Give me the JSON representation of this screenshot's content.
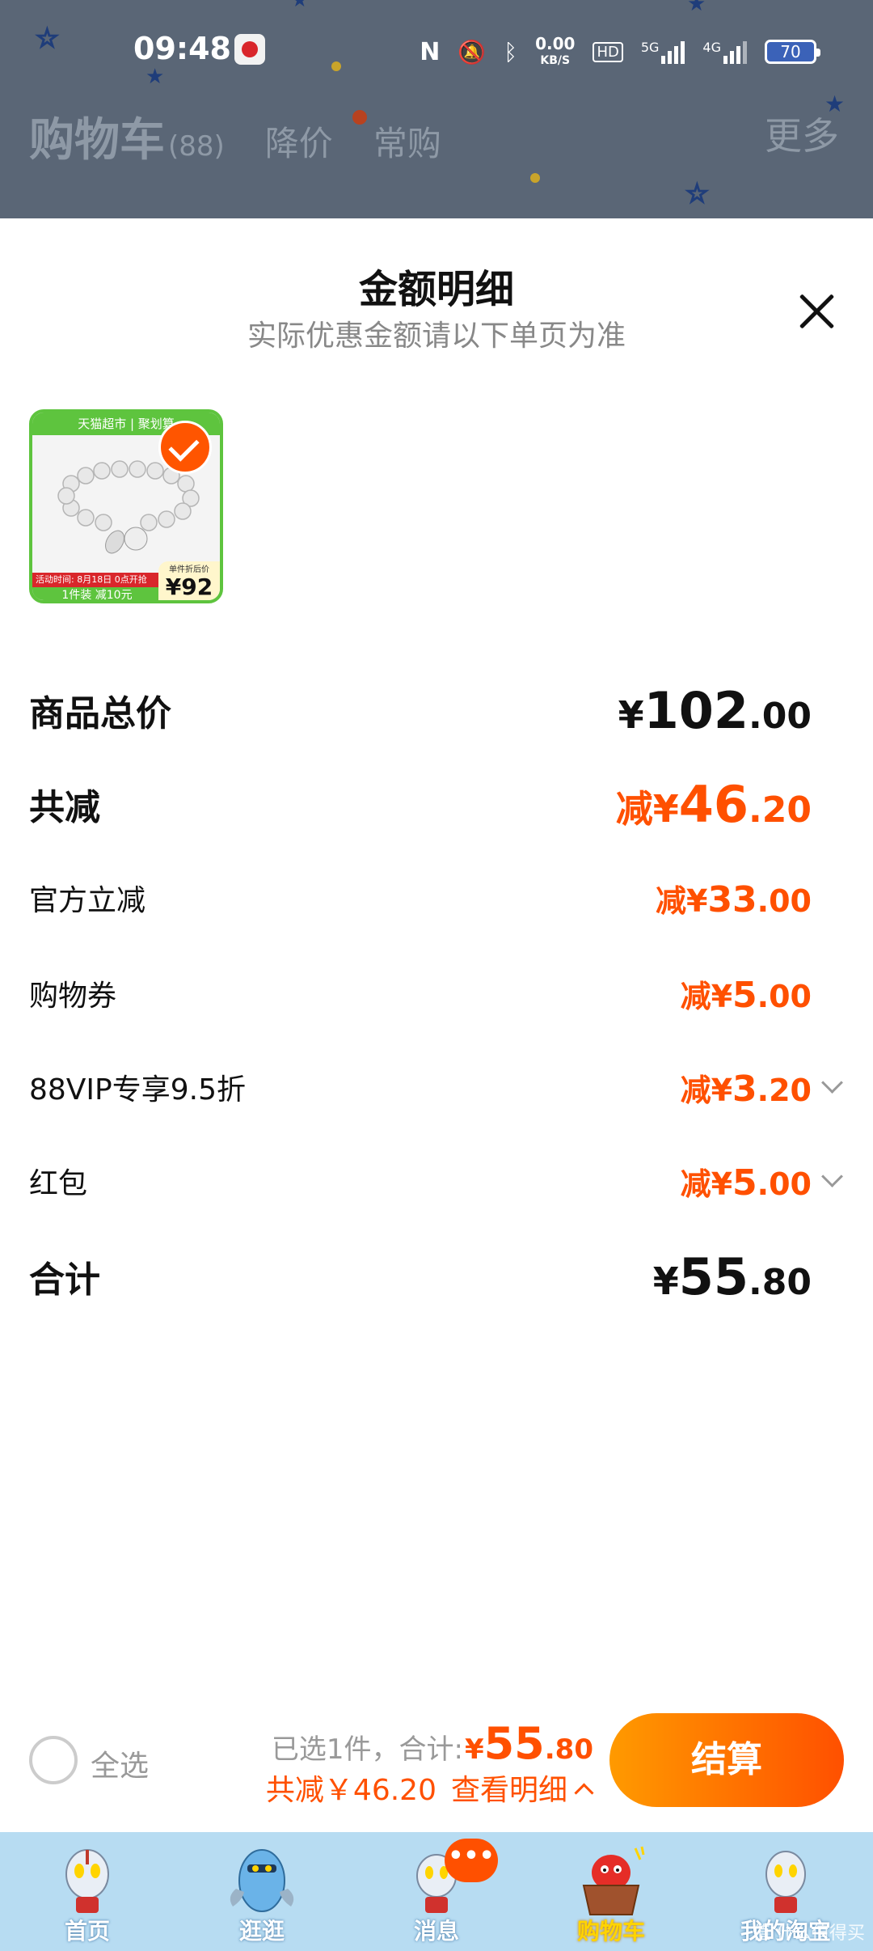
{
  "status_bar": {
    "time": "09:48",
    "net_speed_value": "0.00",
    "net_speed_unit": "KB/S",
    "hd_label": "HD",
    "signal1_label": "5G",
    "signal2_label": "4G",
    "battery": "70",
    "icons": [
      "nfc-icon",
      "mute-icon",
      "bluetooth-icon"
    ]
  },
  "cart_header": {
    "title": "购物车",
    "count": "(88)",
    "tabs": [
      "降价",
      "常购"
    ],
    "more": "更多"
  },
  "sheet": {
    "title": "金额明细",
    "subtitle": "实际优惠金额请以下单页为准"
  },
  "product": {
    "banner": "天猫超市 | 聚划算",
    "promo_line": "活动时间: 8月18日 0点开抢",
    "promo_line2": "1件装 减10元",
    "price_label": "单件折后价",
    "price": "92"
  },
  "rows": [
    {
      "label": "商品总价",
      "prefix": "",
      "currency": "¥",
      "int": "102",
      "dec": ".00"
    },
    {
      "label": "共减",
      "prefix": "减",
      "currency": "¥",
      "int": "46",
      "dec": ".20"
    },
    {
      "label": "官方立减",
      "prefix": "减",
      "currency": "¥",
      "int": "33",
      "dec": ".00"
    },
    {
      "label": "购物券",
      "prefix": "减",
      "currency": "¥",
      "int": "5",
      "dec": ".00"
    },
    {
      "label": "88VIP专享9.5折",
      "prefix": "减",
      "currency": "¥",
      "int": "3",
      "dec": ".20"
    },
    {
      "label": "红包",
      "prefix": "减",
      "currency": "¥",
      "int": "5",
      "dec": ".00"
    },
    {
      "label": "合计",
      "prefix": "",
      "currency": "¥",
      "int": "55",
      "dec": ".80"
    }
  ],
  "checkout": {
    "select_all": "全选",
    "selected_text": "已选1件，合计:",
    "total_currency": "¥",
    "total_int": "55",
    "total_dec": ".80",
    "discount_text": "共减￥46.20",
    "detail_link": "查看明细",
    "button": "结算"
  },
  "tabbar": {
    "items": [
      {
        "label": "首页"
      },
      {
        "label": "逛逛"
      },
      {
        "label": "消息"
      },
      {
        "label": "购物车"
      },
      {
        "label": "我的淘宝"
      }
    ],
    "message_badge": "•••",
    "watermark": "值 什么值得买"
  },
  "colors": {
    "accent": "#ff5000",
    "dim_bg": "#5a6676",
    "tabbar_bg": "#b7dcf2"
  }
}
